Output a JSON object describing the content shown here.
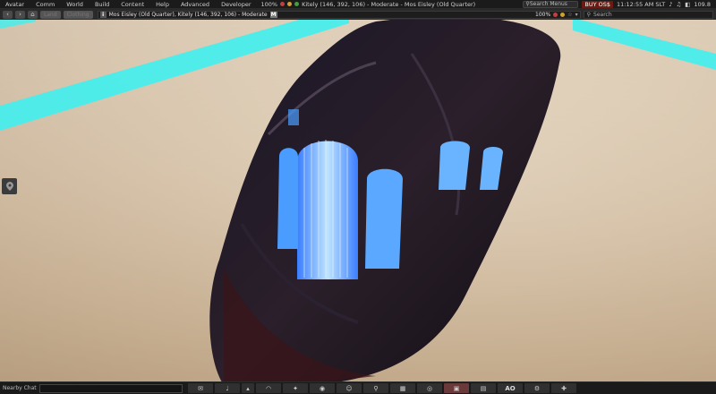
{
  "menubar": {
    "items": [
      "Avatar",
      "Comm",
      "World",
      "Build",
      "Content",
      "Help",
      "Advanced",
      "Developer"
    ],
    "bandwidth_left": "100%",
    "region_info": "Kitely (146, 392, 106) - Moderate - Mos Eisley (Old Quarter)",
    "search_placeholder": "Search Menus",
    "buy_label": "BUY OS$",
    "time": "11:12:55 AM SLT",
    "fps": "109.8"
  },
  "navbar": {
    "home_label": "⌂",
    "btn_labels": [
      "Land",
      "Clothing"
    ],
    "location": "Mos Eisley (Old Quarter), Kitely (146, 392, 106) - Moderate",
    "maturity_badge": "M",
    "info_badge": "i",
    "zoom": "100%",
    "search_placeholder": "Search"
  },
  "bottombar": {
    "chat_label": "Nearby Chat",
    "ao_label": "AO"
  },
  "colors": {
    "beam": "#3ff0f0",
    "ship_glow": "#5fb0ff",
    "buy_button": "#6b1b12"
  }
}
